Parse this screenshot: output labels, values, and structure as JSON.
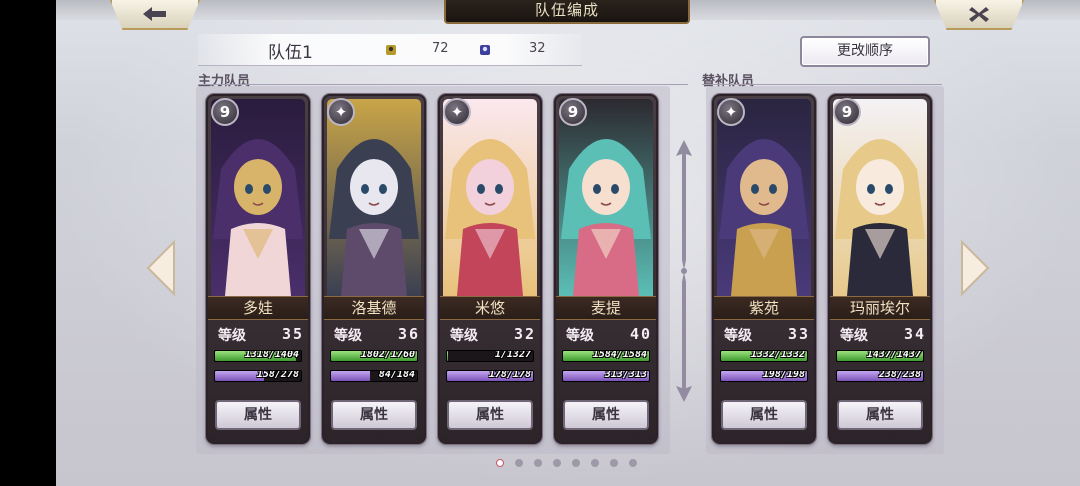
{
  "header": {
    "title": "队伍编成",
    "back_icon": "back-arrow-icon",
    "close_icon": "close-icon"
  },
  "team": {
    "name": "队伍1",
    "stat_a_icon": "gold-unit-icon",
    "stat_a": "72",
    "stat_b_icon": "blue-unit-icon",
    "stat_b": "32",
    "reorder_label": "更改顺序"
  },
  "sections": {
    "main": "主力队员",
    "reserve": "替补队员"
  },
  "labels": {
    "level": "等级",
    "attr": "属性"
  },
  "main_members": [
    {
      "name": "多娃",
      "level": "35",
      "hp": "1318/1404",
      "hp_frac": 0.939,
      "mp": "158/278",
      "mp_frac": 0.568,
      "badge": "9",
      "palette": [
        "#4a2f6b",
        "#d8b46a",
        "#f0d6d6",
        "#2a1c3d"
      ]
    },
    {
      "name": "洛基德",
      "level": "36",
      "hp": "1802/1760",
      "hp_frac": 1.0,
      "mp": "84/184",
      "mp_frac": 0.457,
      "badge": "✦",
      "palette": [
        "#3a3f52",
        "#e8e6ee",
        "#5e4a6b",
        "#c9a548"
      ]
    },
    {
      "name": "米悠",
      "level": "32",
      "hp": "1/1327",
      "hp_frac": 0.01,
      "mp": "178/178",
      "mp_frac": 1.0,
      "badge": "✦",
      "palette": [
        "#e8c27a",
        "#f2d0dc",
        "#c2455a",
        "#fbe8ef"
      ]
    },
    {
      "name": "麦提",
      "level": "40",
      "hp": "1584/1584",
      "hp_frac": 1.0,
      "mp": "313/313",
      "mp_frac": 1.0,
      "badge": "9",
      "palette": [
        "#5bbfb6",
        "#f6dfcf",
        "#d86b86",
        "#2c2a30"
      ]
    }
  ],
  "reserve_members": [
    {
      "name": "紫苑",
      "level": "33",
      "hp": "1332/1332",
      "hp_frac": 1.0,
      "mp": "198/198",
      "mp_frac": 1.0,
      "badge": "✦",
      "palette": [
        "#4a3a7a",
        "#e0b98c",
        "#c8a050",
        "#2a2540"
      ]
    },
    {
      "name": "玛丽埃尔",
      "level": "34",
      "hp": "1437/1437",
      "hp_frac": 1.0,
      "mp": "238/238",
      "mp_frac": 1.0,
      "badge": "9",
      "palette": [
        "#e7c98a",
        "#f8ebdd",
        "#2b2a3b",
        "#f4f2f6"
      ]
    }
  ],
  "pagination": {
    "count": 8,
    "active": 0
  },
  "nav": {
    "prev_icon": "chevron-left-icon",
    "next_icon": "chevron-right-icon",
    "divider_icon": "vertical-double-arrow-icon"
  }
}
